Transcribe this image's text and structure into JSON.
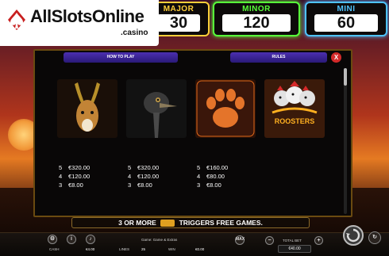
{
  "logo": {
    "brand": "AllSlotsOnline",
    "sub": ".casino"
  },
  "jackpots": {
    "major": {
      "label": "MAJOR",
      "value": "30"
    },
    "minor": {
      "label": "MINOR",
      "value": "120"
    },
    "mini": {
      "label": "MINI",
      "value": "60"
    }
  },
  "paytable": {
    "tabs": {
      "how_to_play": "HOW TO PLAY",
      "rules": "RULES"
    },
    "close_label": "X",
    "symbols": [
      {
        "name": "antelope",
        "pays": [
          {
            "count": "5",
            "amount": "€320.00"
          },
          {
            "count": "4",
            "amount": "€120.00"
          },
          {
            "count": "3",
            "amount": "€8.00"
          }
        ]
      },
      {
        "name": "ostrich",
        "pays": [
          {
            "count": "5",
            "amount": "€320.00"
          },
          {
            "count": "4",
            "amount": "€120.00"
          },
          {
            "count": "3",
            "amount": "€8.00"
          }
        ]
      },
      {
        "name": "paw",
        "pays": [
          {
            "count": "5",
            "amount": "€160.00"
          },
          {
            "count": "4",
            "amount": "€80.00"
          },
          {
            "count": "3",
            "amount": "€8.00"
          }
        ]
      },
      {
        "name": "raging-roosters",
        "title": "ROOSTERS"
      }
    ],
    "free_games_banner": {
      "pre": "3 OR MORE",
      "post": "TRIGGERS FREE GAMES."
    }
  },
  "bottom": {
    "cash_label": "CASH",
    "cash_value": "€4.00",
    "lines_label": "LINES",
    "lines_value": "25",
    "win_label": "WIN",
    "win_value": "€0.00",
    "game_title": "Game: Game & Extras",
    "total_bet_label": "TOTAL BET",
    "total_bet_value": "€40.00",
    "max_label": "MAX"
  },
  "colors": {
    "major": "#ffcf3a",
    "minor": "#58ff3a",
    "mini": "#4fc3ff",
    "tab": "#4b2fb0",
    "close": "#d52a2a"
  }
}
